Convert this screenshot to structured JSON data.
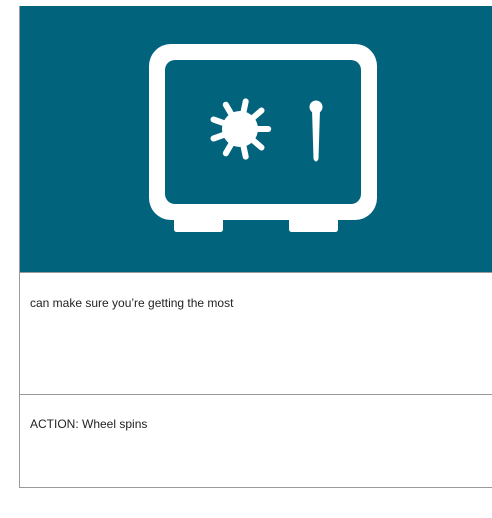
{
  "colors": {
    "illustration_background": "#02637d",
    "icon_color": "#ffffff",
    "border": "#9a9a9a"
  },
  "illustration": {
    "icon": "safe-vault-icon"
  },
  "script_panel": {
    "text": "can make sure you’re getting the most"
  },
  "action_panel": {
    "text": "ACTION: Wheel spins"
  }
}
